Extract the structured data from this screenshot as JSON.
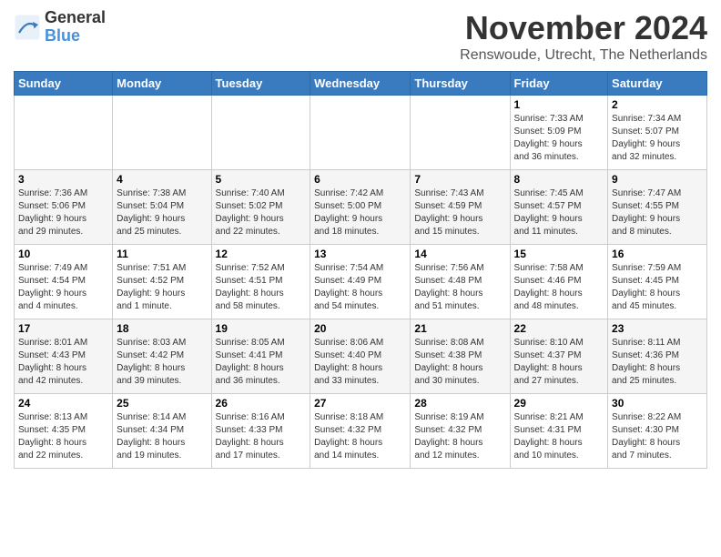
{
  "header": {
    "logo_line1": "General",
    "logo_line2": "Blue",
    "month_title": "November 2024",
    "location": "Renswoude, Utrecht, The Netherlands"
  },
  "weekdays": [
    "Sunday",
    "Monday",
    "Tuesday",
    "Wednesday",
    "Thursday",
    "Friday",
    "Saturday"
  ],
  "weeks": [
    [
      {
        "day": "",
        "info": ""
      },
      {
        "day": "",
        "info": ""
      },
      {
        "day": "",
        "info": ""
      },
      {
        "day": "",
        "info": ""
      },
      {
        "day": "",
        "info": ""
      },
      {
        "day": "1",
        "info": "Sunrise: 7:33 AM\nSunset: 5:09 PM\nDaylight: 9 hours\nand 36 minutes."
      },
      {
        "day": "2",
        "info": "Sunrise: 7:34 AM\nSunset: 5:07 PM\nDaylight: 9 hours\nand 32 minutes."
      }
    ],
    [
      {
        "day": "3",
        "info": "Sunrise: 7:36 AM\nSunset: 5:06 PM\nDaylight: 9 hours\nand 29 minutes."
      },
      {
        "day": "4",
        "info": "Sunrise: 7:38 AM\nSunset: 5:04 PM\nDaylight: 9 hours\nand 25 minutes."
      },
      {
        "day": "5",
        "info": "Sunrise: 7:40 AM\nSunset: 5:02 PM\nDaylight: 9 hours\nand 22 minutes."
      },
      {
        "day": "6",
        "info": "Sunrise: 7:42 AM\nSunset: 5:00 PM\nDaylight: 9 hours\nand 18 minutes."
      },
      {
        "day": "7",
        "info": "Sunrise: 7:43 AM\nSunset: 4:59 PM\nDaylight: 9 hours\nand 15 minutes."
      },
      {
        "day": "8",
        "info": "Sunrise: 7:45 AM\nSunset: 4:57 PM\nDaylight: 9 hours\nand 11 minutes."
      },
      {
        "day": "9",
        "info": "Sunrise: 7:47 AM\nSunset: 4:55 PM\nDaylight: 9 hours\nand 8 minutes."
      }
    ],
    [
      {
        "day": "10",
        "info": "Sunrise: 7:49 AM\nSunset: 4:54 PM\nDaylight: 9 hours\nand 4 minutes."
      },
      {
        "day": "11",
        "info": "Sunrise: 7:51 AM\nSunset: 4:52 PM\nDaylight: 9 hours\nand 1 minute."
      },
      {
        "day": "12",
        "info": "Sunrise: 7:52 AM\nSunset: 4:51 PM\nDaylight: 8 hours\nand 58 minutes."
      },
      {
        "day": "13",
        "info": "Sunrise: 7:54 AM\nSunset: 4:49 PM\nDaylight: 8 hours\nand 54 minutes."
      },
      {
        "day": "14",
        "info": "Sunrise: 7:56 AM\nSunset: 4:48 PM\nDaylight: 8 hours\nand 51 minutes."
      },
      {
        "day": "15",
        "info": "Sunrise: 7:58 AM\nSunset: 4:46 PM\nDaylight: 8 hours\nand 48 minutes."
      },
      {
        "day": "16",
        "info": "Sunrise: 7:59 AM\nSunset: 4:45 PM\nDaylight: 8 hours\nand 45 minutes."
      }
    ],
    [
      {
        "day": "17",
        "info": "Sunrise: 8:01 AM\nSunset: 4:43 PM\nDaylight: 8 hours\nand 42 minutes."
      },
      {
        "day": "18",
        "info": "Sunrise: 8:03 AM\nSunset: 4:42 PM\nDaylight: 8 hours\nand 39 minutes."
      },
      {
        "day": "19",
        "info": "Sunrise: 8:05 AM\nSunset: 4:41 PM\nDaylight: 8 hours\nand 36 minutes."
      },
      {
        "day": "20",
        "info": "Sunrise: 8:06 AM\nSunset: 4:40 PM\nDaylight: 8 hours\nand 33 minutes."
      },
      {
        "day": "21",
        "info": "Sunrise: 8:08 AM\nSunset: 4:38 PM\nDaylight: 8 hours\nand 30 minutes."
      },
      {
        "day": "22",
        "info": "Sunrise: 8:10 AM\nSunset: 4:37 PM\nDaylight: 8 hours\nand 27 minutes."
      },
      {
        "day": "23",
        "info": "Sunrise: 8:11 AM\nSunset: 4:36 PM\nDaylight: 8 hours\nand 25 minutes."
      }
    ],
    [
      {
        "day": "24",
        "info": "Sunrise: 8:13 AM\nSunset: 4:35 PM\nDaylight: 8 hours\nand 22 minutes."
      },
      {
        "day": "25",
        "info": "Sunrise: 8:14 AM\nSunset: 4:34 PM\nDaylight: 8 hours\nand 19 minutes."
      },
      {
        "day": "26",
        "info": "Sunrise: 8:16 AM\nSunset: 4:33 PM\nDaylight: 8 hours\nand 17 minutes."
      },
      {
        "day": "27",
        "info": "Sunrise: 8:18 AM\nSunset: 4:32 PM\nDaylight: 8 hours\nand 14 minutes."
      },
      {
        "day": "28",
        "info": "Sunrise: 8:19 AM\nSunset: 4:32 PM\nDaylight: 8 hours\nand 12 minutes."
      },
      {
        "day": "29",
        "info": "Sunrise: 8:21 AM\nSunset: 4:31 PM\nDaylight: 8 hours\nand 10 minutes."
      },
      {
        "day": "30",
        "info": "Sunrise: 8:22 AM\nSunset: 4:30 PM\nDaylight: 8 hours\nand 7 minutes."
      }
    ]
  ]
}
